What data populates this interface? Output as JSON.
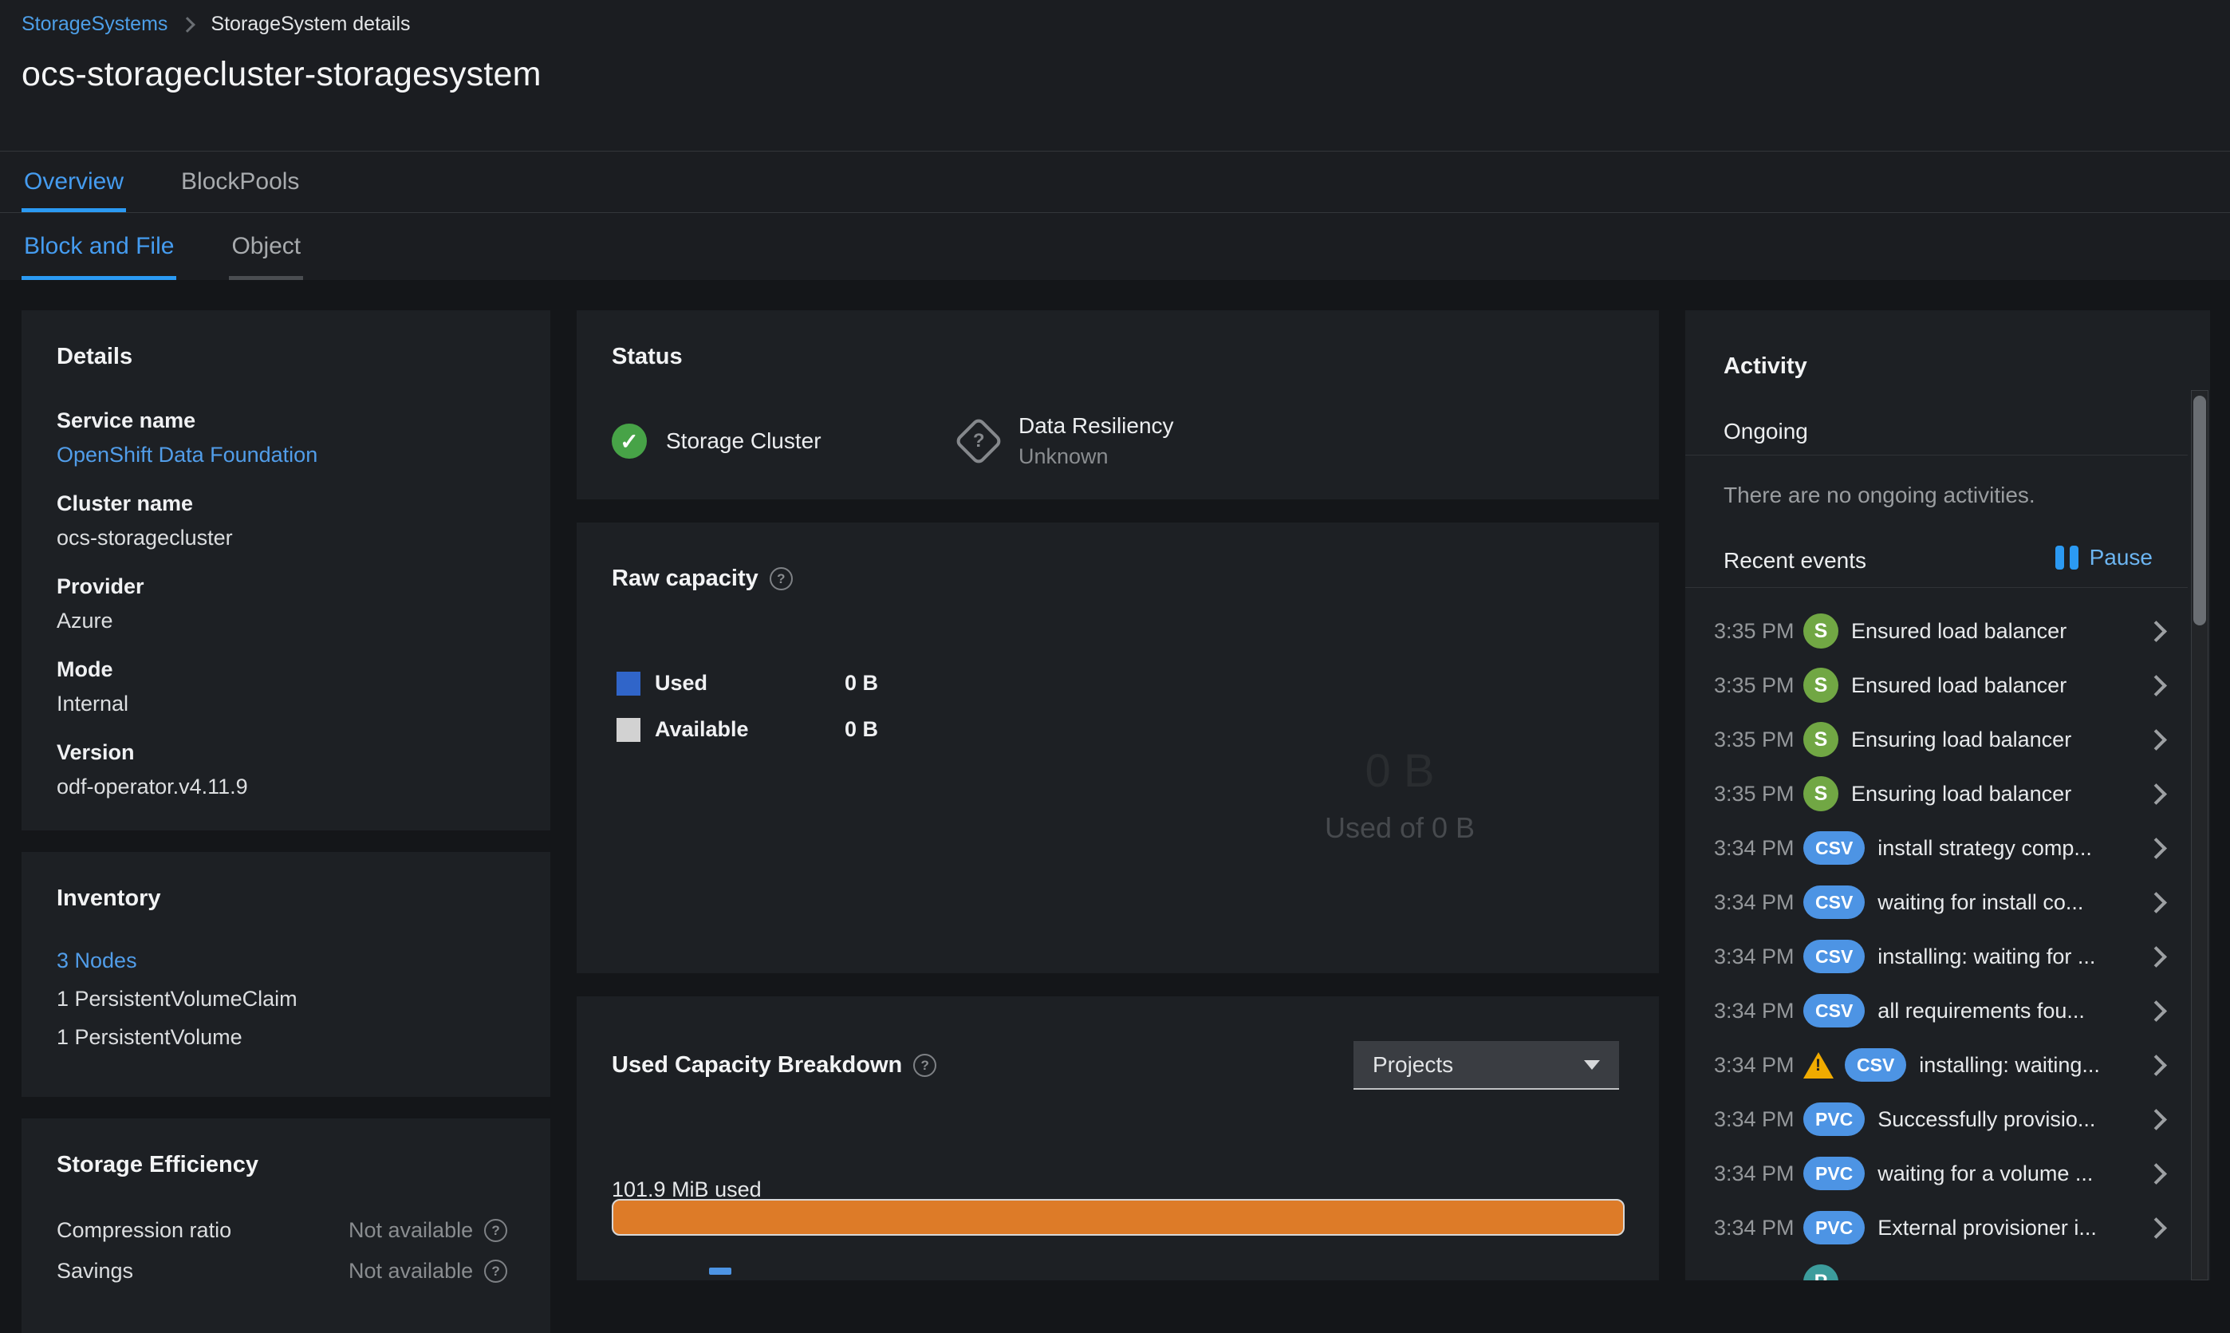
{
  "breadcrumb": {
    "link": "StorageSystems",
    "current": "StorageSystem details"
  },
  "page": {
    "title": "ocs-storagecluster-storagesystem"
  },
  "tabs": {
    "primary": [
      {
        "label": "Overview"
      },
      {
        "label": "BlockPools"
      }
    ],
    "secondary": [
      {
        "label": "Block and File"
      },
      {
        "label": "Object"
      }
    ]
  },
  "details": {
    "title": "Details",
    "fields": [
      {
        "label": "Service name",
        "value": "OpenShift Data Foundation"
      },
      {
        "label": "Cluster name",
        "value": "ocs-storagecluster"
      },
      {
        "label": "Provider",
        "value": "Azure"
      },
      {
        "label": "Mode",
        "value": "Internal"
      },
      {
        "label": "Version",
        "value": "odf-operator.v4.11.9"
      }
    ]
  },
  "inventory": {
    "title": "Inventory",
    "items": [
      {
        "label": "3 Nodes"
      },
      {
        "label": "1 PersistentVolumeClaim"
      },
      {
        "label": "1 PersistentVolume"
      }
    ]
  },
  "storage_efficiency": {
    "title": "Storage Efficiency",
    "rows": [
      {
        "label": "Compression ratio",
        "value": "Not available"
      },
      {
        "label": "Savings",
        "value": "Not available"
      }
    ]
  },
  "status": {
    "title": "Status",
    "items": [
      {
        "label": "Storage Cluster",
        "state": "success"
      },
      {
        "label": "Data Resiliency",
        "sub": "Unknown",
        "state": "unknown"
      }
    ]
  },
  "raw_capacity": {
    "title": "Raw capacity",
    "legend": [
      {
        "label": "Used",
        "value": "0 B",
        "color": "#3065c9"
      },
      {
        "label": "Available",
        "value": "0 B",
        "color": "#d2d2d2"
      }
    ],
    "center_value": "0 B",
    "center_caption": "Used of 0 B"
  },
  "used_capacity_breakdown": {
    "title": "Used Capacity Breakdown",
    "filter": "Projects",
    "usage": "101.9 MiB used",
    "bar_color": "#dd7b28"
  },
  "activity": {
    "title": "Activity",
    "ongoing_header": "Ongoing",
    "ongoing_empty": "There are no ongoing activities.",
    "recent_header": "Recent events",
    "pause_label": "Pause",
    "events": [
      {
        "time": "3:35 PM",
        "kind": "S",
        "text": "Ensured load balancer"
      },
      {
        "time": "3:35 PM",
        "kind": "S",
        "text": "Ensured load balancer"
      },
      {
        "time": "3:35 PM",
        "kind": "S",
        "text": "Ensuring load balancer"
      },
      {
        "time": "3:35 PM",
        "kind": "S",
        "text": "Ensuring load balancer"
      },
      {
        "time": "3:34 PM",
        "kind": "CSV",
        "text": "install strategy comp..."
      },
      {
        "time": "3:34 PM",
        "kind": "CSV",
        "text": "waiting for install co..."
      },
      {
        "time": "3:34 PM",
        "kind": "CSV",
        "text": "installing: waiting for ..."
      },
      {
        "time": "3:34 PM",
        "kind": "CSV",
        "text": "all requirements fou..."
      },
      {
        "time": "3:34 PM",
        "kind": "CSV",
        "text": "installing: waiting...",
        "warning": true
      },
      {
        "time": "3:34 PM",
        "kind": "PVC",
        "text": "Successfully provisio..."
      },
      {
        "time": "3:34 PM",
        "kind": "PVC",
        "text": "waiting for a volume ..."
      },
      {
        "time": "3:34 PM",
        "kind": "PVC",
        "text": "External provisioner i..."
      },
      {
        "time": "",
        "kind": "P",
        "text": ""
      }
    ]
  },
  "colors": {
    "accent_blue": "#2b9af3",
    "link_blue": "#519de9",
    "success_green": "#47a347",
    "badge_green": "#71a744",
    "badge_blue": "#4d94e4",
    "badge_teal": "#3c9c9c",
    "warning_yellow": "#f0ab00",
    "bar_orange": "#dd7b28",
    "used_blue": "#3065c9",
    "available_gray": "#d2d2d2",
    "card_background": "#1d2024",
    "page_background": "#141619"
  }
}
